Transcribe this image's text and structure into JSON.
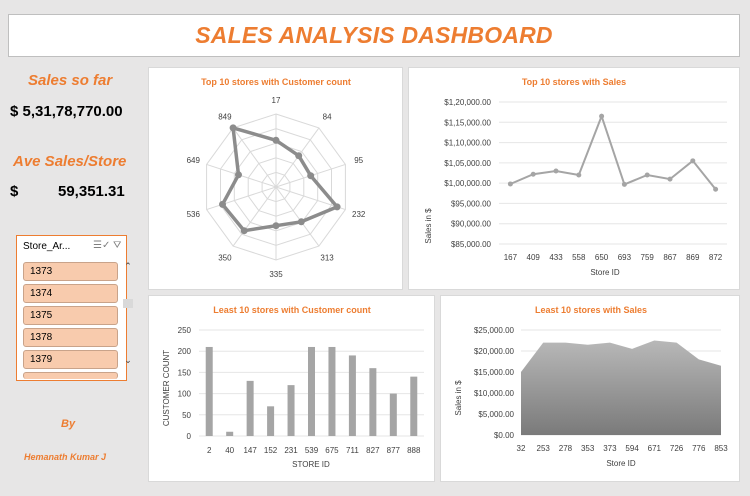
{
  "title": "SALES ANALYSIS DASHBOARD",
  "kpis": {
    "sales_label": "Sales so far",
    "sales_value": "$ 5,31,78,770.00",
    "ave_label": "Ave Sales/Store",
    "ave_currency": "$",
    "ave_value": "59,351.31"
  },
  "slicer": {
    "header": "Store_Ar...",
    "items": [
      "1373",
      "1374",
      "1375",
      "1378",
      "1379"
    ]
  },
  "author": {
    "by": "By",
    "name": "Hemanath Kumar J"
  },
  "colors": {
    "accent": "#ed7d31",
    "series": "#a5a5a5",
    "slicer_item": "#f8cbad"
  },
  "icons": [
    "multi-select-icon",
    "clear-filter-icon",
    "scroll-up-icon",
    "scroll-down-icon"
  ],
  "chart_data": [
    {
      "type": "radar",
      "title": "Top 10 stores with Customer count",
      "categories": [
        "17",
        "84",
        "95",
        "232",
        "313",
        "335",
        "350",
        "536",
        "649",
        "849"
      ],
      "values": [
        640,
        530,
        500,
        880,
        590,
        530,
        740,
        770,
        540,
        1000
      ],
      "max": 1000,
      "rings": 5
    },
    {
      "type": "line",
      "title": "Top 10 stores with Sales",
      "categories": [
        "167",
        "409",
        "433",
        "558",
        "650",
        "693",
        "759",
        "867",
        "869",
        "872"
      ],
      "values": [
        99800,
        102200,
        103000,
        102000,
        116500,
        99700,
        102000,
        101000,
        105500,
        98500
      ],
      "ylim": [
        85000,
        120000
      ],
      "yticks": [
        "$85,000.00",
        "$90,000.00",
        "$95,000.00",
        "$1,00,000.00",
        "$1,05,000.00",
        "$1,10,000.00",
        "$1,15,000.00",
        "$1,20,000.00"
      ],
      "xlabel": "Store ID",
      "ylabel": "Sales in $"
    },
    {
      "type": "bar",
      "title": "Least 10 stores with Customer count",
      "categories": [
        "2",
        "40",
        "147",
        "152",
        "231",
        "539",
        "675",
        "711",
        "827",
        "877",
        "888"
      ],
      "values": [
        210,
        10,
        130,
        70,
        120,
        210,
        210,
        190,
        160,
        100,
        140
      ],
      "ylim": [
        0,
        250
      ],
      "yticks": [
        "0",
        "50",
        "100",
        "150",
        "200",
        "250"
      ],
      "xlabel": "STORE ID",
      "ylabel": "CUSTOMER COUNT"
    },
    {
      "type": "area",
      "title": "Least 10 stores with Sales",
      "categories": [
        "32",
        "253",
        "278",
        "353",
        "373",
        "594",
        "671",
        "726",
        "776",
        "853"
      ],
      "values": [
        15000,
        22000,
        22000,
        21500,
        22000,
        20500,
        22500,
        22000,
        18000,
        16500
      ],
      "ylim": [
        0,
        25000
      ],
      "yticks": [
        "$0.00",
        "$5,000.00",
        "$10,000.00",
        "$15,000.00",
        "$20,000.00",
        "$25,000.00"
      ],
      "xlabel": "Store ID",
      "ylabel": "Sales in $"
    }
  ]
}
